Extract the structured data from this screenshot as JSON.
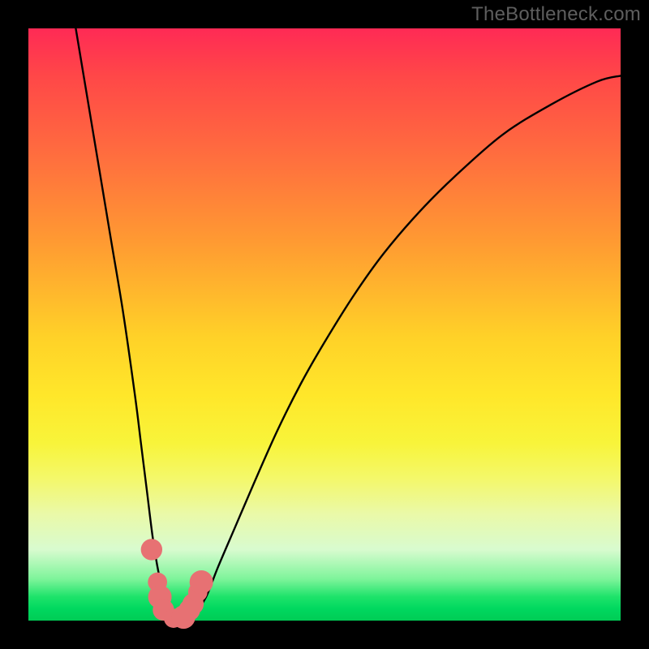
{
  "watermark": "TheBottleneck.com",
  "chart_data": {
    "type": "line",
    "title": "",
    "xlabel": "",
    "ylabel": "",
    "xlim": [
      0,
      100
    ],
    "ylim": [
      0,
      100
    ],
    "series": [
      {
        "name": "bottleneck-curve",
        "x": [
          8,
          10,
          12,
          14,
          16,
          18,
          19,
          20,
          21,
          22,
          23,
          24,
          25,
          26,
          27,
          28,
          30,
          32,
          35,
          38,
          42,
          46,
          50,
          55,
          60,
          66,
          72,
          80,
          88,
          96,
          100
        ],
        "values": [
          100,
          88,
          76,
          64,
          52,
          38,
          30,
          22,
          14,
          8,
          4,
          1,
          0,
          0,
          0,
          1,
          4,
          9,
          16,
          23,
          32,
          40,
          47,
          55,
          62,
          69,
          75,
          82,
          87,
          91,
          92
        ]
      }
    ],
    "markers": [
      {
        "x": 20.8,
        "y": 12.0,
        "r": 1.4
      },
      {
        "x": 21.8,
        "y": 6.5,
        "r": 1.2
      },
      {
        "x": 22.2,
        "y": 4.0,
        "r": 1.6
      },
      {
        "x": 22.8,
        "y": 1.8,
        "r": 1.4
      },
      {
        "x": 24.5,
        "y": 0.4,
        "r": 1.2
      },
      {
        "x": 26.2,
        "y": 0.6,
        "r": 1.6
      },
      {
        "x": 27.2,
        "y": 1.8,
        "r": 1.4
      },
      {
        "x": 27.8,
        "y": 2.8,
        "r": 1.4
      },
      {
        "x": 28.6,
        "y": 4.8,
        "r": 1.2
      },
      {
        "x": 29.2,
        "y": 6.5,
        "r": 1.6
      }
    ],
    "gradient_colors": {
      "top": "#ff2a55",
      "mid1": "#ff9a32",
      "mid2": "#ffe72a",
      "bottom": "#00cc55"
    },
    "marker_color": "#e77173",
    "curve_color": "#000000"
  }
}
